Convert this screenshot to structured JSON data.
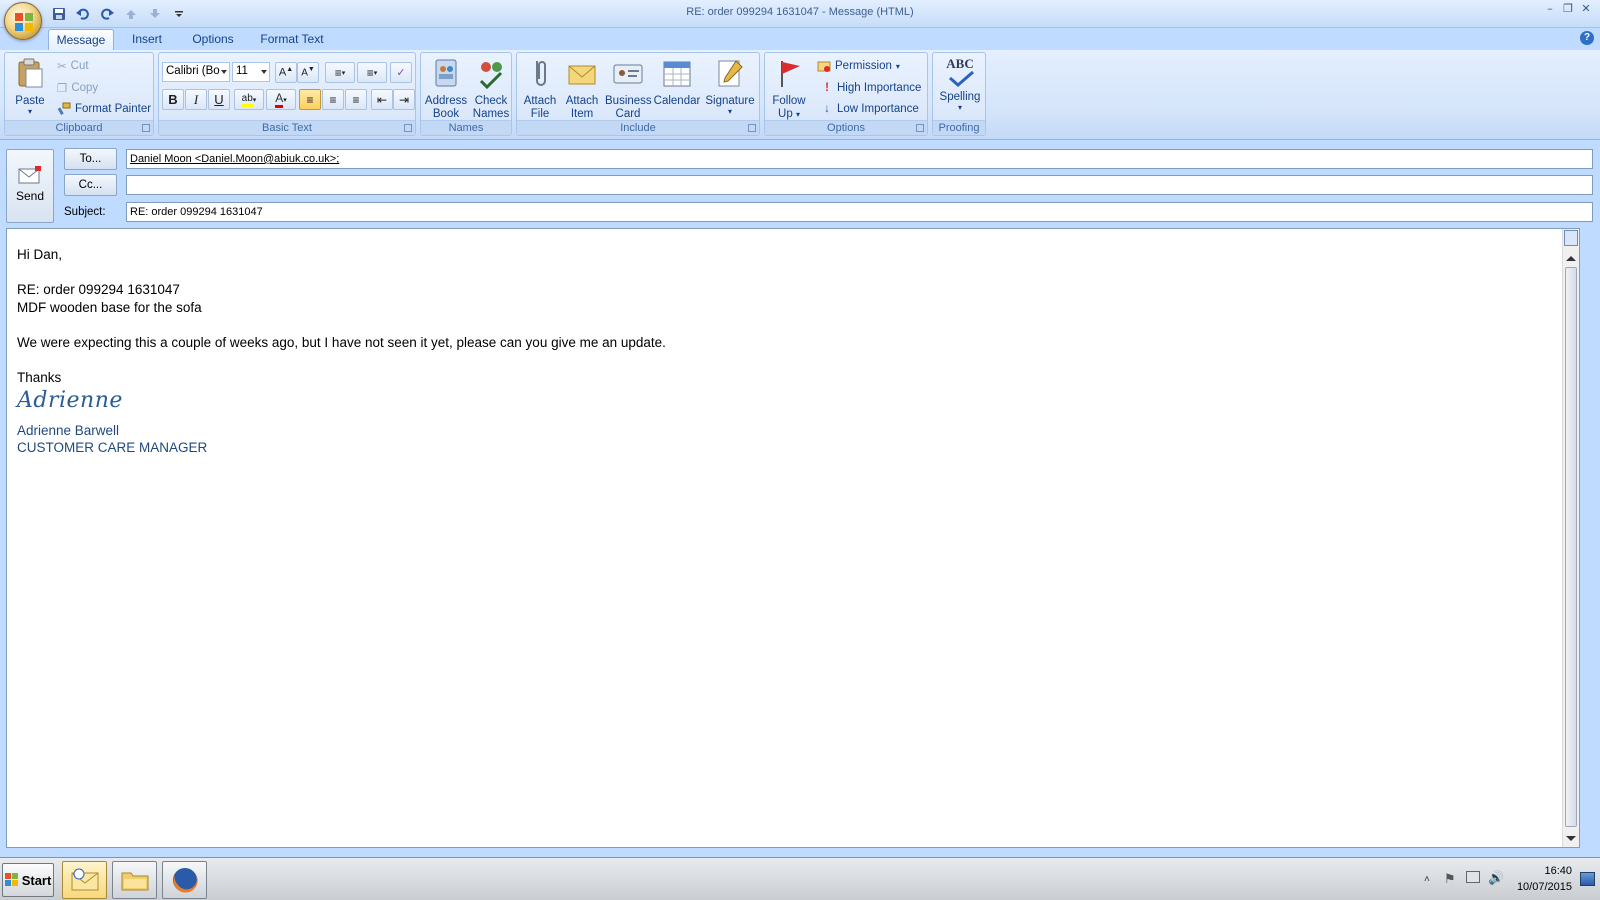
{
  "window": {
    "title": "RE: order 099294  1631047 - Message (HTML)",
    "controls": [
      "minimize-icon",
      "restore-icon",
      "close-icon"
    ]
  },
  "quick_access": [
    "save-icon",
    "undo-icon",
    "redo-icon",
    "previous-item-icon",
    "next-item-icon",
    "customize-dropdown-icon"
  ],
  "tabs": [
    {
      "label": "Message",
      "active": true
    },
    {
      "label": "Insert",
      "active": false
    },
    {
      "label": "Options",
      "active": false
    },
    {
      "label": "Format Text",
      "active": false
    }
  ],
  "ribbon": {
    "clipboard": {
      "label": "Clipboard",
      "paste": "Paste",
      "cut": "Cut",
      "copy": "Copy",
      "format_painter": "Format Painter"
    },
    "basic_text": {
      "label": "Basic Text",
      "font_name": "Calibri (Bo",
      "font_size": "11",
      "bold": "B",
      "italic": "I",
      "underline": "U"
    },
    "names": {
      "label": "Names",
      "address_book_1": "Address",
      "address_book_2": "Book",
      "check_names_1": "Check",
      "check_names_2": "Names"
    },
    "include": {
      "label": "Include",
      "attach_file_1": "Attach",
      "attach_file_2": "File",
      "attach_item_1": "Attach",
      "attach_item_2": "Item",
      "business_card_1": "Business",
      "business_card_2": "Card",
      "calendar": "Calendar",
      "signature": "Signature"
    },
    "options": {
      "label": "Options",
      "follow_up_1": "Follow",
      "follow_up_2": "Up",
      "permission": "Permission",
      "high_importance": "High Importance",
      "low_importance": "Low Importance"
    },
    "proofing": {
      "label": "Proofing",
      "spelling_icon_text": "ABC",
      "spelling": "Spelling"
    }
  },
  "compose": {
    "send": "Send",
    "to_button": "To...",
    "cc_button": "Cc...",
    "subject_label": "Subject:",
    "to_value": "Daniel Moon <Daniel.Moon@abiuk.co.uk>;",
    "cc_value": "",
    "subject_value": "RE: order 099294  1631047"
  },
  "message": {
    "greeting": "Hi Dan,",
    "line1": "RE: order 099294  1631047",
    "line2": "MDF wooden base for the sofa",
    "line3": "We were expecting this a couple of weeks ago, but I have not seen it yet, please can you give me an update.",
    "closing": "Thanks",
    "signature_script": "Adrienne",
    "signature_name": "Adrienne Barwell",
    "signature_title": "CUSTOMER CARE MANAGER"
  },
  "taskbar": {
    "start": "Start",
    "apps": [
      "outlook-icon",
      "file-explorer-icon",
      "firefox-icon"
    ],
    "time": "16:40",
    "date": "10/07/2015"
  },
  "colors": {
    "ribbon_text": "#15428b",
    "signature_blue": "#1f497d",
    "frame_blue": "#bfdbff"
  }
}
